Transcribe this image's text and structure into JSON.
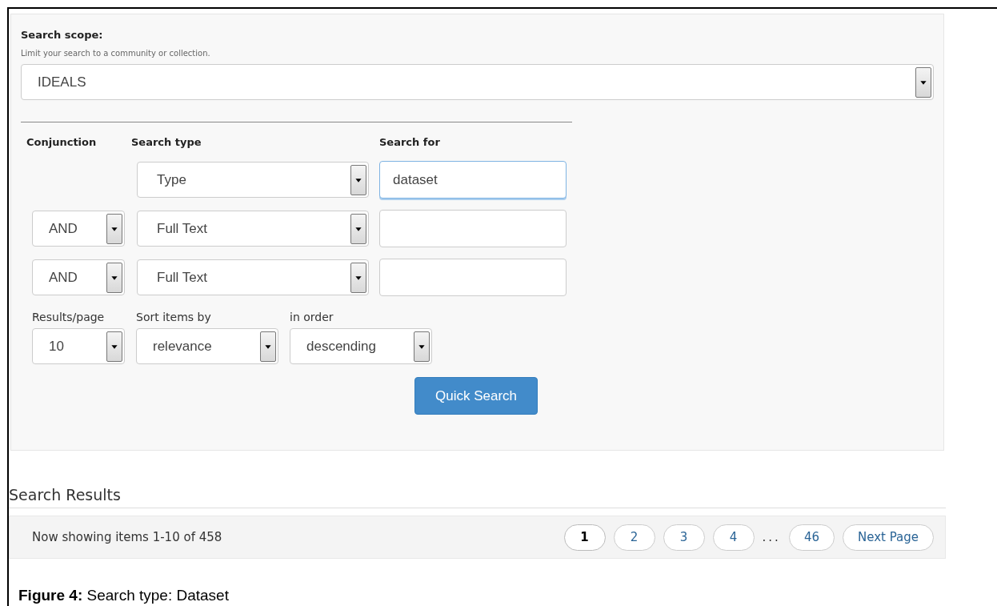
{
  "scope": {
    "label": "Search scope:",
    "hint": "Limit your search to a community or collection.",
    "value": "IDEALS"
  },
  "criteria": {
    "headers": [
      "Conjunction",
      "Search type",
      "Search for"
    ],
    "rows": [
      {
        "type": "Type",
        "query": "dataset",
        "focused": true
      },
      {
        "conjunction": "AND",
        "type": "Full Text",
        "focused": false
      },
      {
        "conjunction": "AND",
        "type": "Full Text",
        "focused": false
      }
    ]
  },
  "options": [
    {
      "label": "Results/page",
      "value": "10"
    },
    {
      "label": "Sort items by",
      "value": "relevance"
    },
    {
      "label": "in order",
      "value": "descending"
    }
  ],
  "submit": "Quick Search",
  "results": {
    "title": "Search Results",
    "summary": "Now showing items 1-10 of 458",
    "pages": [
      {
        "label": "1",
        "selected": true
      },
      {
        "label": "2",
        "selected": false
      },
      {
        "label": "3",
        "selected": false
      },
      {
        "label": "4",
        "selected": false
      },
      {
        "label": "...",
        "kind": "gap"
      },
      {
        "label": "46",
        "selected": false
      },
      {
        "label": "Next Page",
        "selected": false
      }
    ]
  },
  "caption": "**Figure 4:** Search type: Dataset"
}
